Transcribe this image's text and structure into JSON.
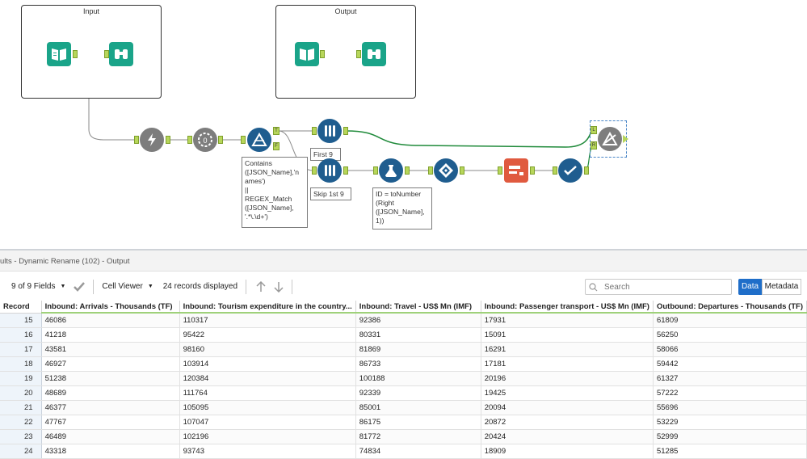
{
  "canvas": {
    "containers": [
      {
        "title": "Input"
      },
      {
        "title": "Output"
      }
    ],
    "anchor_labels": {
      "true": "T",
      "false": "F",
      "left": "L",
      "right": "R"
    },
    "annotations": {
      "filter": "Contains\n([JSON_Name],'n\names')\n||\nREGEX_Match\n([JSON_Name],\n'.*\\.\\d+')",
      "first9": "First 9",
      "skip9": "Skip 1st 9",
      "formula": "ID = toNumber\n(Right\n([JSON_Name],\n1))"
    },
    "tool_icons": [
      "input-data-icon",
      "browse-icon",
      "input-data-icon",
      "browse-icon",
      "json-parse-icon",
      "regex-icon",
      "filter-icon",
      "sample-icon",
      "sample-icon",
      "formula-icon",
      "cross-tab-icon",
      "dynamic-rename-icon",
      "select-icon",
      "join-icon"
    ],
    "colors": {
      "input": "#1aa489",
      "browse": "#1aa489",
      "parse": "#7d7d7d",
      "blue": "#1f5d8f",
      "crosstab": "#e05a3f",
      "wire_main": "#1f8a3a",
      "wire": "#8a8a8a"
    }
  },
  "results": {
    "title": "ults - Dynamic Rename (102) - Output",
    "fields_label": "9 of 9 Fields",
    "viewer_label": "Cell Viewer",
    "records_label": "24 records displayed",
    "search_placeholder": "Search",
    "data_label": "Data",
    "metadata_label": "Metadata",
    "columns": [
      "Record",
      "Inbound: Arrivals - Thousands (TF)",
      "Inbound: Tourism expenditure in the country...",
      "Inbound: Travel - US$ Mn (IMF)",
      "Inbound: Passenger transport - US$ Mn (IMF)",
      "Outbound: Departures - Thousands (TF)"
    ],
    "rows": [
      [
        "15",
        "46086",
        "110317",
        "92386",
        "17931",
        "61809"
      ],
      [
        "16",
        "41218",
        "95422",
        "80331",
        "15091",
        "56250"
      ],
      [
        "17",
        "43581",
        "98160",
        "81869",
        "16291",
        "58066"
      ],
      [
        "18",
        "46927",
        "103914",
        "86733",
        "17181",
        "59442"
      ],
      [
        "19",
        "51238",
        "120384",
        "100188",
        "20196",
        "61327"
      ],
      [
        "20",
        "48689",
        "111764",
        "92339",
        "19425",
        "57222"
      ],
      [
        "21",
        "46377",
        "105095",
        "85001",
        "20094",
        "55696"
      ],
      [
        "22",
        "47767",
        "107047",
        "86175",
        "20872",
        "53229"
      ],
      [
        "23",
        "46489",
        "102196",
        "81772",
        "20424",
        "52999"
      ],
      [
        "24",
        "43318",
        "93743",
        "74834",
        "18909",
        "51285"
      ]
    ]
  }
}
